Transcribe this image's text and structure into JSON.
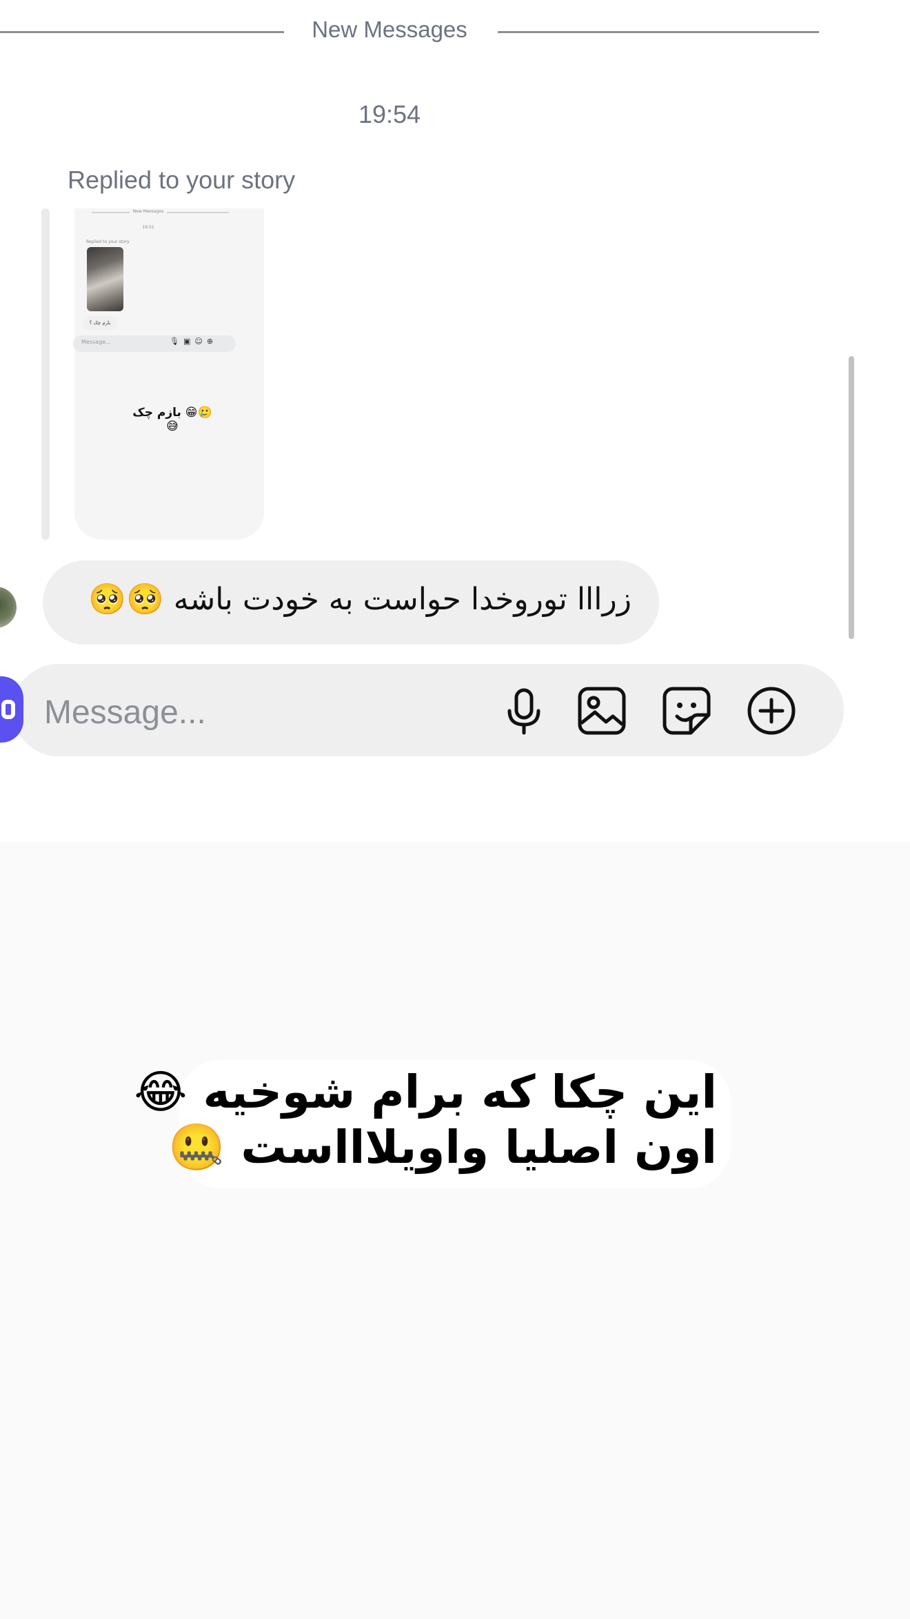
{
  "divider": {
    "label": "New Messages"
  },
  "thread": {
    "timestamp": "19:54",
    "reply_label": "Replied to your story",
    "story_preview": {
      "header": "New Messages",
      "time": "19:51",
      "replied": "Replied to your story",
      "bubble": "بازم چک ؟",
      "composer_placeholder": "Message...",
      "caption": "بازم چک 😁🥲😅"
    },
    "message_text": "زرااا توروخدا حواست به خودت باشه 🥺🥺"
  },
  "composer": {
    "placeholder": "Message...",
    "icons": [
      "camera-icon",
      "microphone-icon",
      "image-icon",
      "sticker-icon",
      "plus-circle-icon"
    ]
  },
  "story_overlay": {
    "line1": "این چکا که برام شوخیه 😂",
    "line2": "اون اصلیا واویلاااست 🤐"
  },
  "colors": {
    "accent": "#5b50f0",
    "bubble": "#efeff0",
    "muted_text": "#6c7280"
  }
}
